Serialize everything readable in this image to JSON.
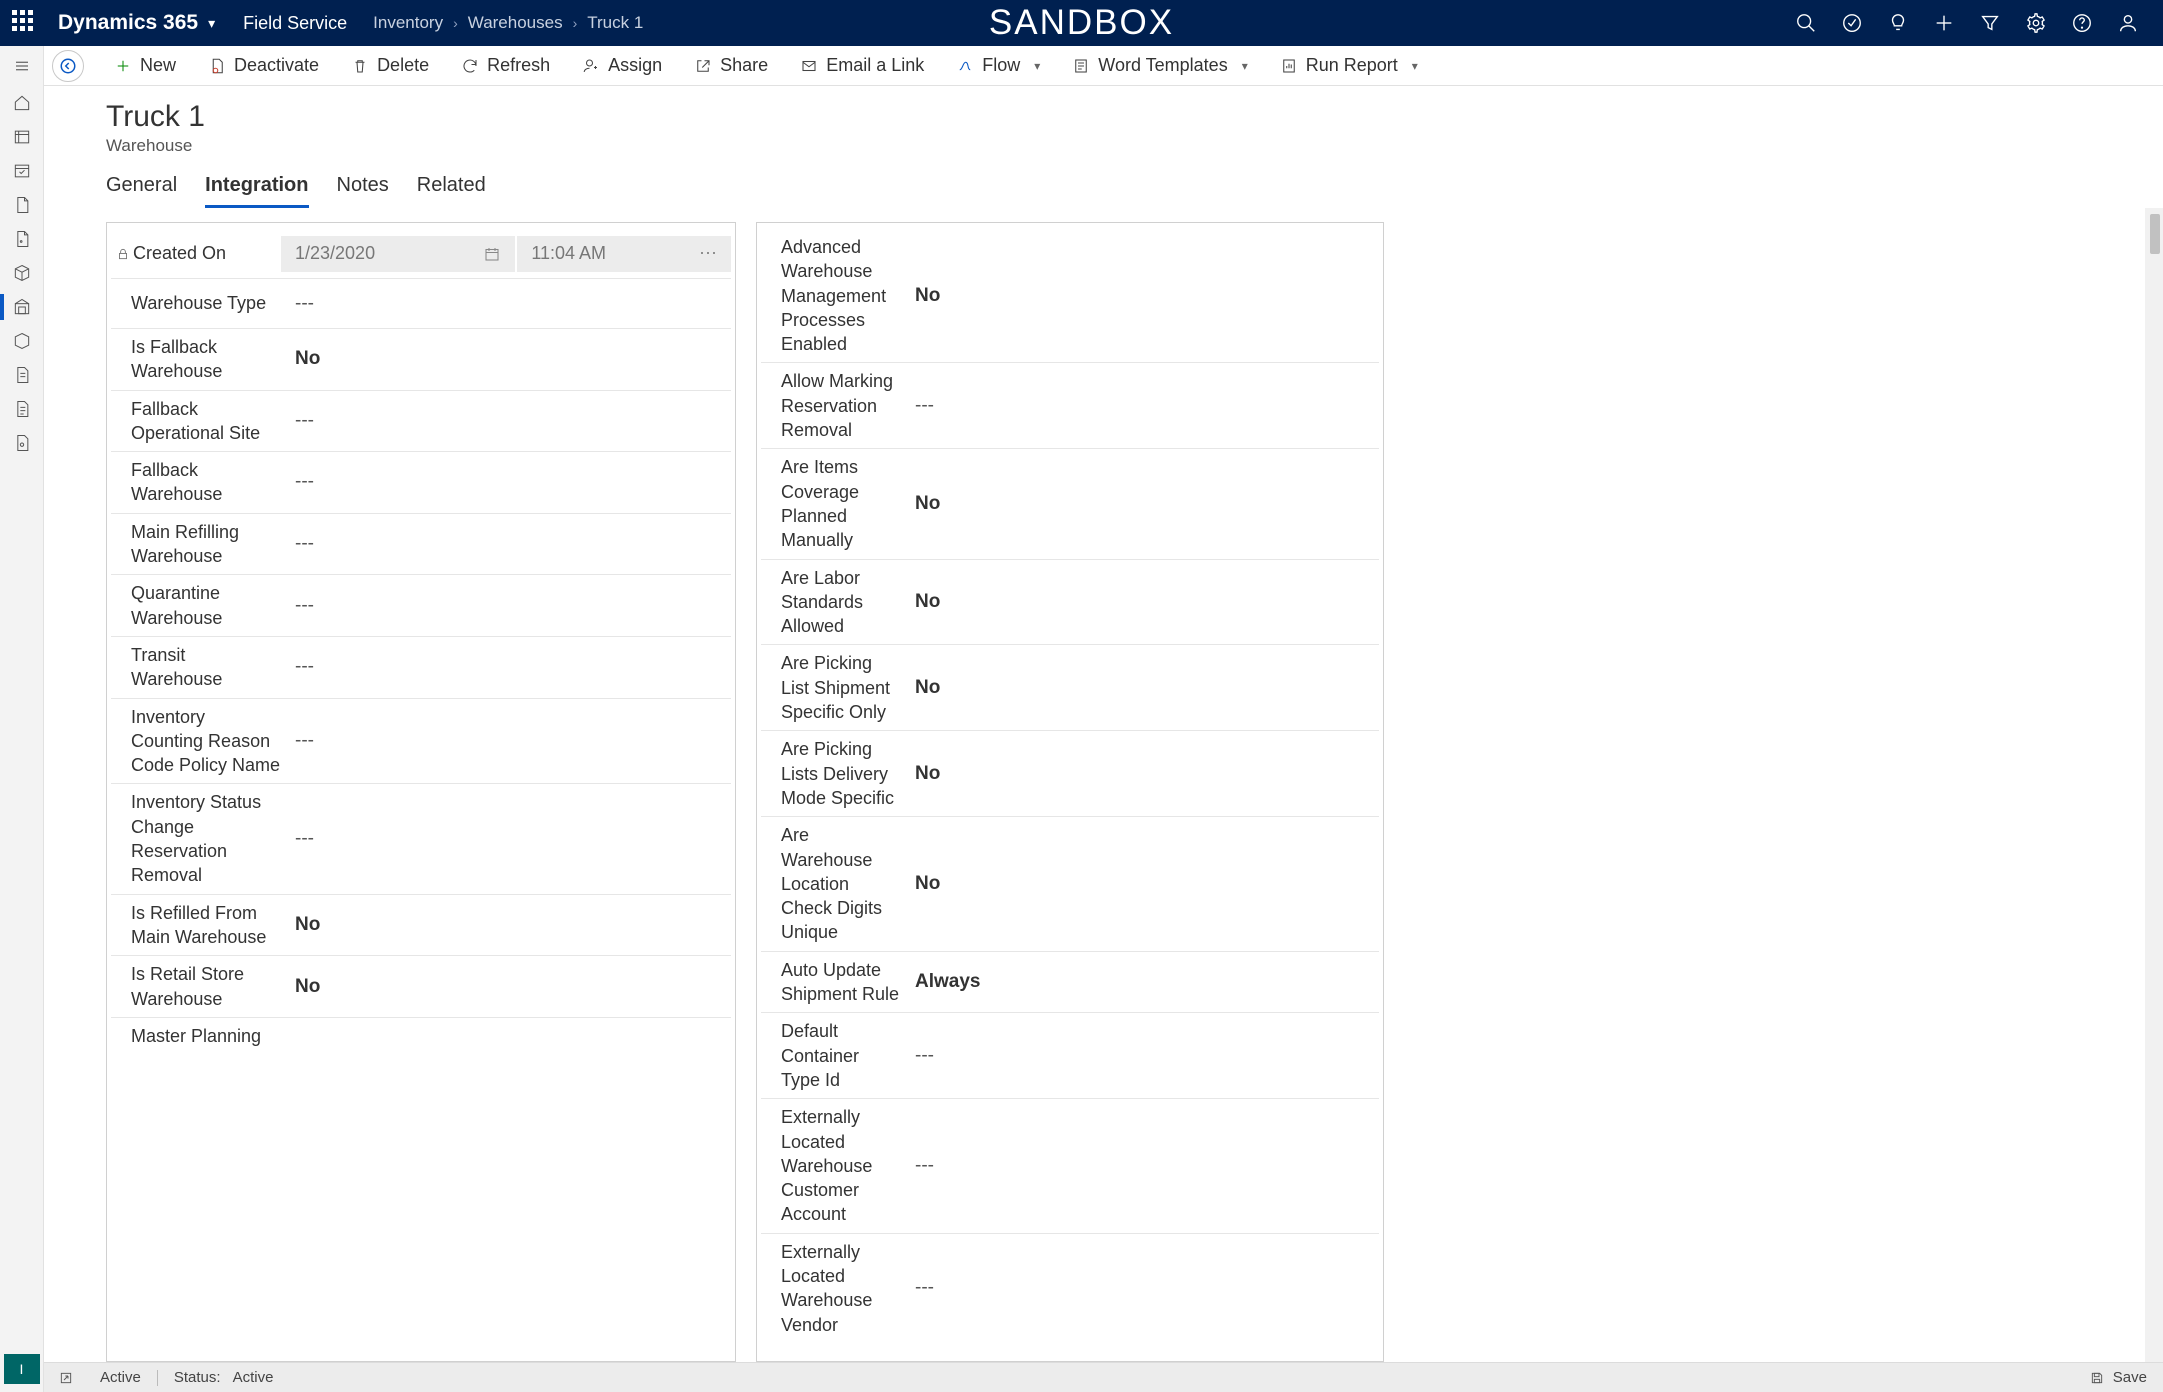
{
  "topbar": {
    "brand": "Dynamics 365",
    "app": "Field Service",
    "breadcrumb": [
      "Inventory",
      "Warehouses",
      "Truck 1"
    ],
    "sandbox_label": "SANDBOX"
  },
  "commands": {
    "new": "New",
    "deactivate": "Deactivate",
    "delete": "Delete",
    "refresh": "Refresh",
    "assign": "Assign",
    "share": "Share",
    "email_link": "Email a Link",
    "flow": "Flow",
    "word_templates": "Word Templates",
    "run_report": "Run Report"
  },
  "record": {
    "title": "Truck 1",
    "subtitle": "Warehouse",
    "tabs": {
      "general": "General",
      "integration": "Integration",
      "notes": "Notes",
      "related": "Related"
    }
  },
  "left_section": {
    "created_on_label": "Created On",
    "created_on_date": "1/23/2020",
    "created_on_time": "11:04 AM",
    "fields": [
      {
        "label": "Warehouse Type",
        "value": "---"
      },
      {
        "label": "Is Fallback Warehouse",
        "value": "No",
        "bold": true
      },
      {
        "label": "Fallback Operational Site",
        "value": "---"
      },
      {
        "label": "Fallback Warehouse",
        "value": "---"
      },
      {
        "label": "Main Refilling Warehouse",
        "value": "---"
      },
      {
        "label": "Quarantine Warehouse",
        "value": "---"
      },
      {
        "label": "Transit Warehouse",
        "value": "---"
      },
      {
        "label": "Inventory Counting Reason Code Policy Name",
        "value": "---"
      },
      {
        "label": "Inventory Status Change Reservation Removal",
        "value": "---"
      },
      {
        "label": "Is Refilled From Main Warehouse",
        "value": "No",
        "bold": true
      },
      {
        "label": "Is Retail Store Warehouse",
        "value": "No",
        "bold": true
      },
      {
        "label": "Master Planning",
        "value": "",
        "cut": true
      }
    ]
  },
  "right_section": {
    "fields": [
      {
        "label": "Advanced Warehouse Management Processes Enabled",
        "value": "No",
        "bold": true
      },
      {
        "label": "Allow Marking Reservation Removal",
        "value": "---"
      },
      {
        "label": "Are Items Coverage Planned Manually",
        "value": "No",
        "bold": true
      },
      {
        "label": "Are Labor Standards Allowed",
        "value": "No",
        "bold": true
      },
      {
        "label": "Are Picking List Shipment Specific Only",
        "value": "No",
        "bold": true
      },
      {
        "label": "Are Picking Lists Delivery Mode Specific",
        "value": "No",
        "bold": true
      },
      {
        "label": "Are Warehouse Location Check Digits Unique",
        "value": "No",
        "bold": true
      },
      {
        "label": "Auto Update Shipment Rule",
        "value": "Always",
        "bold": true
      },
      {
        "label": "Default Container Type Id",
        "value": "---"
      },
      {
        "label": "Externally Located Warehouse Customer Account",
        "value": "---"
      },
      {
        "label": "Externally Located Warehouse Vendor",
        "value": "---",
        "cut": true
      }
    ]
  },
  "statusbar": {
    "state": "Active",
    "status_label": "Status:",
    "status_value": "Active",
    "save": "Save"
  },
  "area_switch": "I"
}
